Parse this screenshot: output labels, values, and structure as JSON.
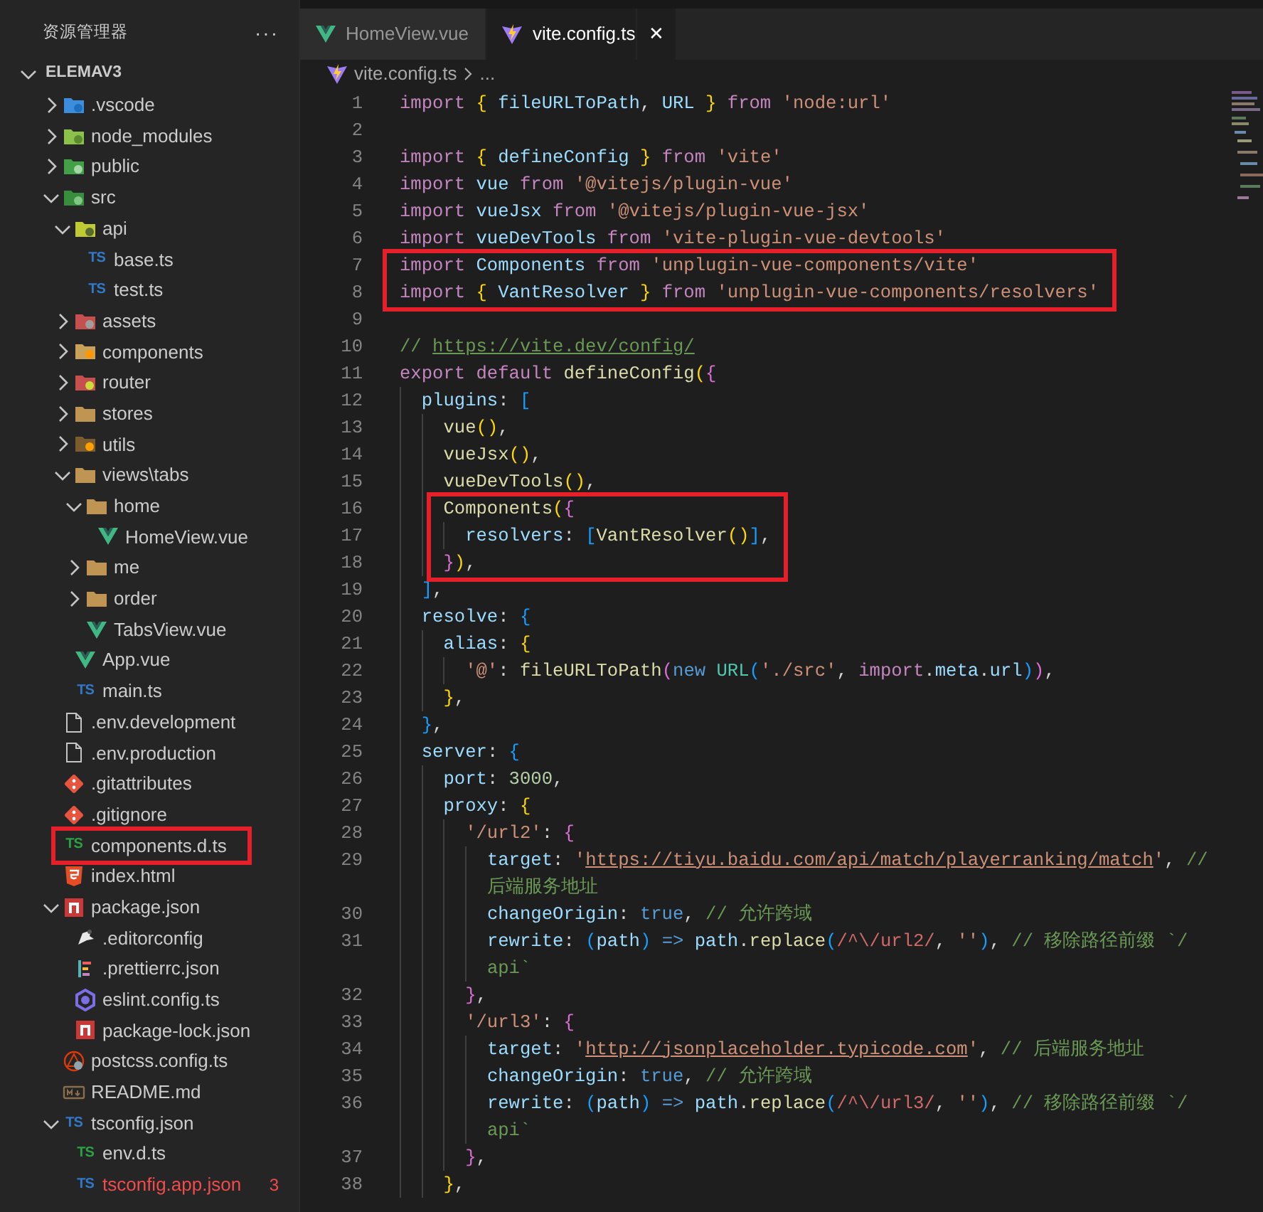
{
  "sidebar": {
    "title": "资源管理器",
    "more": "···",
    "project": {
      "title": "ELEMAV3",
      "expanded": true
    },
    "tree": [
      {
        "label": ".vscode",
        "kind": "folder-vscode",
        "expanded": false
      },
      {
        "label": "node_modules",
        "kind": "folder-node",
        "expanded": false
      },
      {
        "label": "public",
        "kind": "folder-public",
        "expanded": false
      },
      {
        "label": "src",
        "kind": "folder-src",
        "expanded": true,
        "children": [
          {
            "label": "api",
            "kind": "folder-api",
            "expanded": true,
            "children": [
              {
                "label": "base.ts",
                "kind": "ts",
                "icon_label": "TS"
              },
              {
                "label": "test.ts",
                "kind": "ts",
                "icon_label": "TS"
              }
            ]
          },
          {
            "label": "assets",
            "kind": "folder-assets",
            "expanded": false
          },
          {
            "label": "components",
            "kind": "folder-components",
            "expanded": false
          },
          {
            "label": "router",
            "kind": "folder-router",
            "expanded": false
          },
          {
            "label": "stores",
            "kind": "folder",
            "expanded": false
          },
          {
            "label": "utils",
            "kind": "folder-utils",
            "expanded": false
          },
          {
            "label": "views\\tabs",
            "kind": "folder",
            "expanded": true,
            "children": [
              {
                "label": "home",
                "kind": "folder",
                "expanded": true,
                "children": [
                  {
                    "label": "HomeView.vue",
                    "kind": "vue"
                  }
                ]
              },
              {
                "label": "me",
                "kind": "folder",
                "expanded": false
              },
              {
                "label": "order",
                "kind": "folder",
                "expanded": false
              },
              {
                "label": "TabsView.vue",
                "kind": "vue"
              }
            ]
          },
          {
            "label": "App.vue",
            "kind": "vue"
          },
          {
            "label": "main.ts",
            "kind": "ts",
            "icon_label": "TS"
          }
        ]
      },
      {
        "label": ".env.development",
        "kind": "file"
      },
      {
        "label": ".env.production",
        "kind": "file"
      },
      {
        "label": ".gitattributes",
        "kind": "git"
      },
      {
        "label": ".gitignore",
        "kind": "git"
      },
      {
        "label": "components.d.ts",
        "kind": "ts-declaration",
        "icon_label": "TS",
        "boxed": true
      },
      {
        "label": "index.html",
        "kind": "html"
      },
      {
        "label": "package.json",
        "kind": "npm",
        "expanded": true,
        "children": [
          {
            "label": ".editorconfig",
            "kind": "editorconfig"
          },
          {
            "label": ".prettierrc.json",
            "kind": "prettier"
          },
          {
            "label": "eslint.config.ts",
            "kind": "eslint"
          },
          {
            "label": "package-lock.json",
            "kind": "npm"
          }
        ]
      },
      {
        "label": "postcss.config.ts",
        "kind": "postcss"
      },
      {
        "label": "README.md",
        "kind": "markdown"
      },
      {
        "label": "tsconfig.json",
        "kind": "tsconfig",
        "icon_label": "TS",
        "expanded": true,
        "children": [
          {
            "label": "env.d.ts",
            "kind": "ts-declaration",
            "icon_label": "TS"
          },
          {
            "label": "tsconfig.app.json",
            "kind": "tsconfig",
            "icon_label": "TS",
            "error": true,
            "problems": "3"
          }
        ]
      }
    ]
  },
  "tabs": [
    {
      "label": "HomeView.vue",
      "kind": "vue",
      "selected": false
    },
    {
      "label": "vite.config.ts",
      "kind": "vite",
      "selected": true,
      "close": "✕"
    }
  ],
  "breadcrumb": [
    {
      "label": "vite.config.ts",
      "kind": "vite"
    },
    {
      "label": "..."
    }
  ],
  "code_lines": [
    {
      "number": "1",
      "tokens": [
        {
          "kind": "kw",
          "text": "import"
        },
        {
          "kind": "b1",
          "text": " {"
        },
        {
          "kind": "var",
          "text": " fileURLToPath"
        },
        {
          "kind": "p",
          "text": ", "
        },
        {
          "kind": "var",
          "text": "URL "
        },
        {
          "kind": "b1",
          "text": "}"
        },
        {
          "kind": "kw",
          "text": " from"
        },
        {
          "kind": "str",
          "text": " 'node:url'"
        }
      ]
    },
    {
      "number": "2"
    },
    {
      "number": "3",
      "tokens": [
        {
          "kind": "kw",
          "text": "import"
        },
        {
          "kind": "b1",
          "text": " {"
        },
        {
          "kind": "var",
          "text": " defineConfig "
        },
        {
          "kind": "b1",
          "text": "}"
        },
        {
          "kind": "kw",
          "text": " from"
        },
        {
          "kind": "str",
          "text": " 'vite'"
        }
      ]
    },
    {
      "number": "4",
      "tokens": [
        {
          "kind": "kw",
          "text": "import"
        },
        {
          "kind": "var",
          "text": " vue"
        },
        {
          "kind": "kw",
          "text": " from"
        },
        {
          "kind": "str",
          "text": " '@vitejs/plugin-vue'"
        }
      ]
    },
    {
      "number": "5",
      "tokens": [
        {
          "kind": "kw",
          "text": "import"
        },
        {
          "kind": "var",
          "text": " vueJsx"
        },
        {
          "kind": "kw",
          "text": " from"
        },
        {
          "kind": "str",
          "text": " '@vitejs/plugin-vue-jsx'"
        }
      ]
    },
    {
      "number": "6",
      "tokens": [
        {
          "kind": "kw",
          "text": "import"
        },
        {
          "kind": "var",
          "text": " vueDevTools"
        },
        {
          "kind": "kw",
          "text": " from"
        },
        {
          "kind": "str",
          "text": " 'vite-plugin-vue-devtools'"
        }
      ]
    },
    {
      "number": "7",
      "boxed": true,
      "tokens": [
        {
          "kind": "kw",
          "text": "import"
        },
        {
          "kind": "var",
          "text": " Components"
        },
        {
          "kind": "kw",
          "text": " from"
        },
        {
          "kind": "str",
          "text": " 'unplugin-vue-components/vite'"
        }
      ]
    },
    {
      "number": "8",
      "boxed": true,
      "tokens": [
        {
          "kind": "kw",
          "text": "import"
        },
        {
          "kind": "b1",
          "text": " {"
        },
        {
          "kind": "var",
          "text": " VantResolver "
        },
        {
          "kind": "b1",
          "text": "}"
        },
        {
          "kind": "kw",
          "text": " from"
        },
        {
          "kind": "str",
          "text": " 'unplugin-vue-components/resolvers'"
        }
      ]
    },
    {
      "number": "9"
    },
    {
      "number": "10",
      "tokens": [
        {
          "kind": "com",
          "text": "// "
        },
        {
          "kind": "link",
          "text": "https://vite.dev/config/"
        }
      ]
    },
    {
      "number": "11",
      "tokens": [
        {
          "kind": "kw",
          "text": "export default"
        },
        {
          "kind": "fn",
          "text": " defineConfig"
        },
        {
          "kind": "b1",
          "text": "("
        },
        {
          "kind": "b2",
          "text": "{"
        }
      ]
    },
    {
      "number": "12",
      "tokens": [
        {
          "kind": "var",
          "text": "  plugins"
        },
        {
          "kind": "p",
          "text": ": "
        },
        {
          "kind": "b3",
          "text": "["
        }
      ]
    },
    {
      "number": "13",
      "tokens": [
        {
          "kind": "fn",
          "text": "    vue"
        },
        {
          "kind": "b1",
          "text": "()"
        },
        {
          "kind": "p",
          "text": ","
        }
      ]
    },
    {
      "number": "14",
      "tokens": [
        {
          "kind": "fn",
          "text": "    vueJsx"
        },
        {
          "kind": "b1",
          "text": "()"
        },
        {
          "kind": "p",
          "text": ","
        }
      ]
    },
    {
      "number": "15",
      "tokens": [
        {
          "kind": "fn",
          "text": "    vueDevTools"
        },
        {
          "kind": "b1",
          "text": "()"
        },
        {
          "kind": "p",
          "text": ","
        }
      ]
    },
    {
      "number": "16",
      "boxed": true,
      "tokens": [
        {
          "kind": "fn",
          "text": "    Components"
        },
        {
          "kind": "b1",
          "text": "("
        },
        {
          "kind": "b2",
          "text": "{"
        }
      ]
    },
    {
      "number": "17",
      "boxed": true,
      "tokens": [
        {
          "kind": "var",
          "text": "      resolvers"
        },
        {
          "kind": "p",
          "text": ": "
        },
        {
          "kind": "b3",
          "text": "["
        },
        {
          "kind": "fn",
          "text": "VantResolver"
        },
        {
          "kind": "b1",
          "text": "()"
        },
        {
          "kind": "b3",
          "text": "]"
        },
        {
          "kind": "p",
          "text": ","
        }
      ]
    },
    {
      "number": "18",
      "boxed": true,
      "tokens": [
        {
          "kind": "b2",
          "text": "    }"
        },
        {
          "kind": "b1",
          "text": ")"
        },
        {
          "kind": "p",
          "text": ","
        }
      ]
    },
    {
      "number": "19",
      "tokens": [
        {
          "kind": "b3",
          "text": "  ]"
        },
        {
          "kind": "p",
          "text": ","
        }
      ]
    },
    {
      "number": "20",
      "tokens": [
        {
          "kind": "var",
          "text": "  resolve"
        },
        {
          "kind": "p",
          "text": ": "
        },
        {
          "kind": "b3",
          "text": "{"
        }
      ]
    },
    {
      "number": "21",
      "tokens": [
        {
          "kind": "var",
          "text": "    alias"
        },
        {
          "kind": "p",
          "text": ": "
        },
        {
          "kind": "b1",
          "text": "{"
        }
      ]
    },
    {
      "number": "22",
      "tokens": [
        {
          "kind": "str",
          "text": "      '@'"
        },
        {
          "kind": "p",
          "text": ": "
        },
        {
          "kind": "fn",
          "text": "fileURLToPath"
        },
        {
          "kind": "b2",
          "text": "("
        },
        {
          "kind": "blue",
          "text": "new"
        },
        {
          "kind": "cls",
          "text": " URL"
        },
        {
          "kind": "b3",
          "text": "("
        },
        {
          "kind": "str",
          "text": "'./src'"
        },
        {
          "kind": "p",
          "text": ", "
        },
        {
          "kind": "kw",
          "text": "import"
        },
        {
          "kind": "p",
          "text": "."
        },
        {
          "kind": "var",
          "text": "meta"
        },
        {
          "kind": "p",
          "text": "."
        },
        {
          "kind": "var",
          "text": "url"
        },
        {
          "kind": "b3",
          "text": ")"
        },
        {
          "kind": "b2",
          "text": ")"
        },
        {
          "kind": "p",
          "text": ","
        }
      ]
    },
    {
      "number": "23",
      "tokens": [
        {
          "kind": "b1",
          "text": "    }"
        },
        {
          "kind": "p",
          "text": ","
        }
      ]
    },
    {
      "number": "24",
      "tokens": [
        {
          "kind": "b3",
          "text": "  }"
        },
        {
          "kind": "p",
          "text": ","
        }
      ]
    },
    {
      "number": "25",
      "tokens": [
        {
          "kind": "var",
          "text": "  server"
        },
        {
          "kind": "p",
          "text": ": "
        },
        {
          "kind": "b3",
          "text": "{"
        }
      ]
    },
    {
      "number": "26",
      "tokens": [
        {
          "kind": "var",
          "text": "    port"
        },
        {
          "kind": "p",
          "text": ": "
        },
        {
          "kind": "num",
          "text": "3000"
        },
        {
          "kind": "p",
          "text": ","
        }
      ]
    },
    {
      "number": "27",
      "tokens": [
        {
          "kind": "var",
          "text": "    proxy"
        },
        {
          "kind": "p",
          "text": ": "
        },
        {
          "kind": "b1",
          "text": "{"
        }
      ]
    },
    {
      "number": "28",
      "tokens": [
        {
          "kind": "str",
          "text": "      '/url2'"
        },
        {
          "kind": "p",
          "text": ": "
        },
        {
          "kind": "b2",
          "text": "{"
        }
      ]
    },
    {
      "number": "29",
      "tokens": [
        {
          "kind": "var",
          "text": "        target"
        },
        {
          "kind": "p",
          "text": ": "
        },
        {
          "kind": "str",
          "text": "'"
        },
        {
          "kind": "slink",
          "text": "https://tiyu.baidu.com/api/match/playerranking/match"
        },
        {
          "kind": "str",
          "text": "'"
        },
        {
          "kind": "p",
          "text": ", "
        },
        {
          "kind": "com",
          "text": "//"
        }
      ]
    },
    {
      "tokens": [
        {
          "kind": "com",
          "text": "        后端服务地址"
        }
      ]
    },
    {
      "number": "30",
      "tokens": [
        {
          "kind": "var",
          "text": "        changeOrigin"
        },
        {
          "kind": "p",
          "text": ": "
        },
        {
          "kind": "blue",
          "text": "true"
        },
        {
          "kind": "p",
          "text": ", "
        },
        {
          "kind": "com",
          "text": "// 允许跨域"
        }
      ]
    },
    {
      "number": "31",
      "tokens": [
        {
          "kind": "var",
          "text": "        rewrite"
        },
        {
          "kind": "p",
          "text": ": "
        },
        {
          "kind": "b3",
          "text": "("
        },
        {
          "kind": "var",
          "text": "path"
        },
        {
          "kind": "b3",
          "text": ")"
        },
        {
          "kind": "blue",
          "text": " =>"
        },
        {
          "kind": "var",
          "text": " path"
        },
        {
          "kind": "p",
          "text": "."
        },
        {
          "kind": "fn",
          "text": "replace"
        },
        {
          "kind": "b3",
          "text": "("
        },
        {
          "kind": "rx",
          "text": "/^\\/url2/"
        },
        {
          "kind": "p",
          "text": ", "
        },
        {
          "kind": "str",
          "text": "''"
        },
        {
          "kind": "b3",
          "text": ")"
        },
        {
          "kind": "p",
          "text": ", "
        },
        {
          "kind": "com",
          "text": "// 移除路径前缀 `/"
        }
      ]
    },
    {
      "tokens": [
        {
          "kind": "com",
          "text": "        api`"
        }
      ]
    },
    {
      "number": "32",
      "tokens": [
        {
          "kind": "b2",
          "text": "      }"
        },
        {
          "kind": "p",
          "text": ","
        }
      ]
    },
    {
      "number": "33",
      "tokens": [
        {
          "kind": "str",
          "text": "      '/url3'"
        },
        {
          "kind": "p",
          "text": ": "
        },
        {
          "kind": "b2",
          "text": "{"
        }
      ]
    },
    {
      "number": "34",
      "tokens": [
        {
          "kind": "var",
          "text": "        target"
        },
        {
          "kind": "p",
          "text": ": "
        },
        {
          "kind": "str",
          "text": "'"
        },
        {
          "kind": "slink",
          "text": "http://jsonplaceholder.typicode.com"
        },
        {
          "kind": "str",
          "text": "'"
        },
        {
          "kind": "p",
          "text": ", "
        },
        {
          "kind": "com",
          "text": "// 后端服务地址"
        }
      ]
    },
    {
      "number": "35",
      "tokens": [
        {
          "kind": "var",
          "text": "        changeOrigin"
        },
        {
          "kind": "p",
          "text": ": "
        },
        {
          "kind": "blue",
          "text": "true"
        },
        {
          "kind": "p",
          "text": ", "
        },
        {
          "kind": "com",
          "text": "// 允许跨域"
        }
      ]
    },
    {
      "number": "36",
      "tokens": [
        {
          "kind": "var",
          "text": "        rewrite"
        },
        {
          "kind": "p",
          "text": ": "
        },
        {
          "kind": "b3",
          "text": "("
        },
        {
          "kind": "var",
          "text": "path"
        },
        {
          "kind": "b3",
          "text": ")"
        },
        {
          "kind": "blue",
          "text": " =>"
        },
        {
          "kind": "var",
          "text": " path"
        },
        {
          "kind": "p",
          "text": "."
        },
        {
          "kind": "fn",
          "text": "replace"
        },
        {
          "kind": "b3",
          "text": "("
        },
        {
          "kind": "rx",
          "text": "/^\\/url3/"
        },
        {
          "kind": "p",
          "text": ", "
        },
        {
          "kind": "str",
          "text": "''"
        },
        {
          "kind": "b3",
          "text": ")"
        },
        {
          "kind": "p",
          "text": ", "
        },
        {
          "kind": "com",
          "text": "// 移除路径前缀 `/"
        }
      ]
    },
    {
      "tokens": [
        {
          "kind": "com",
          "text": "        api`"
        }
      ]
    },
    {
      "number": "37",
      "tokens": [
        {
          "kind": "b2",
          "text": "      }"
        },
        {
          "kind": "p",
          "text": ","
        }
      ]
    },
    {
      "number": "38",
      "tokens": [
        {
          "kind": "b1",
          "text": "    }"
        },
        {
          "kind": "p",
          "text": ","
        }
      ]
    }
  ]
}
